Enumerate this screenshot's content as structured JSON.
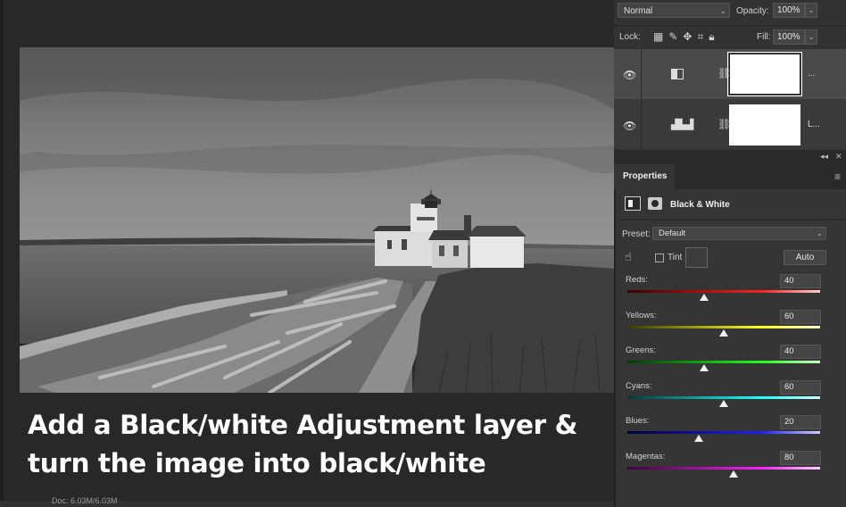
{
  "caption": {
    "line1": "Add a Black/white Adjustment layer &",
    "line2": "turn the image into black/white"
  },
  "status": {
    "doc_size": "Doc: 6.03M/6.03M"
  },
  "layers_panel": {
    "blend_mode": "Normal",
    "opacity_label": "Opacity:",
    "opacity_value": "100%",
    "lock_label": "Lock:",
    "fill_label": "Fill:",
    "fill_value": "100%",
    "layers": [
      {
        "name": "...",
        "type": "black-white-adjustment",
        "selected": true
      },
      {
        "name": "L...",
        "type": "levels-adjustment",
        "selected": false
      }
    ]
  },
  "properties_panel": {
    "tab": "Properties",
    "title": "Black & White",
    "preset_label": "Preset:",
    "preset_value": "Default",
    "tint_label": "Tint",
    "tint_checked": false,
    "auto_label": "Auto",
    "sliders": [
      {
        "label": "Reds:",
        "value": "40",
        "fraction": 0.4,
        "gradient": "linear-gradient(90deg,#3a0000,#ff2020 70%,#ffd0d0)"
      },
      {
        "label": "Yellows:",
        "value": "60",
        "fraction": 0.5,
        "gradient": "linear-gradient(90deg,#3a3a00,#ffff20 70%,#ffffd0)"
      },
      {
        "label": "Greens:",
        "value": "40",
        "fraction": 0.4,
        "gradient": "linear-gradient(90deg,#003a00,#20ff20 70%,#d0ffd0)"
      },
      {
        "label": "Cyans:",
        "value": "60",
        "fraction": 0.5,
        "gradient": "linear-gradient(90deg,#003a3a,#20ffff 70%,#d0ffff)"
      },
      {
        "label": "Blues:",
        "value": "20",
        "fraction": 0.37,
        "gradient": "linear-gradient(90deg,#00003a,#2020ff 70%,#d0d0ff)"
      },
      {
        "label": "Magentas:",
        "value": "80",
        "fraction": 0.55,
        "gradient": "linear-gradient(90deg,#3a003a,#ff20ff 70%,#ffd0ff)"
      }
    ]
  }
}
